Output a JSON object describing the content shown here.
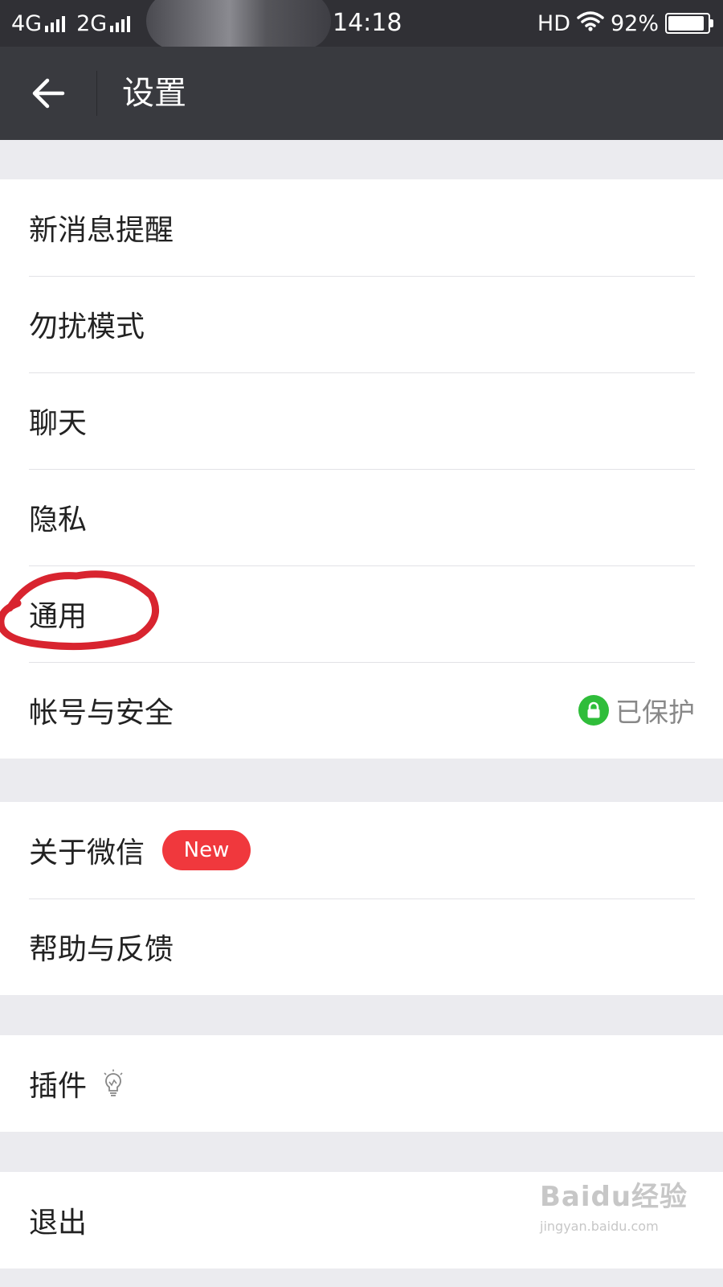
{
  "status_bar": {
    "network_1": "4G",
    "network_2": "2G",
    "time": "14:18",
    "hd": "HD",
    "battery": "92%"
  },
  "header": {
    "title": "设置",
    "back_icon": "back-arrow-icon"
  },
  "groups": [
    {
      "items": [
        {
          "label": "新消息提醒"
        },
        {
          "label": "勿扰模式"
        },
        {
          "label": "聊天"
        },
        {
          "label": "隐私"
        },
        {
          "label": "通用",
          "annotated": true
        },
        {
          "label": "帐号与安全",
          "status": "已保护",
          "status_icon": "lock-icon",
          "status_color": "#2fbd3a"
        }
      ]
    },
    {
      "items": [
        {
          "label": "关于微信",
          "badge": "New",
          "badge_color": "#f0383d"
        },
        {
          "label": "帮助与反馈"
        }
      ]
    },
    {
      "items": [
        {
          "label": "插件",
          "icon": "lightbulb-icon"
        }
      ]
    },
    {
      "items": [
        {
          "label": "退出"
        }
      ]
    }
  ],
  "watermark": {
    "main": "Baidu经验",
    "sub": "jingyan.baidu.com"
  },
  "colors": {
    "header_bg": "#393a3f",
    "page_bg": "#ebebef",
    "annotation": "#d8242f"
  }
}
